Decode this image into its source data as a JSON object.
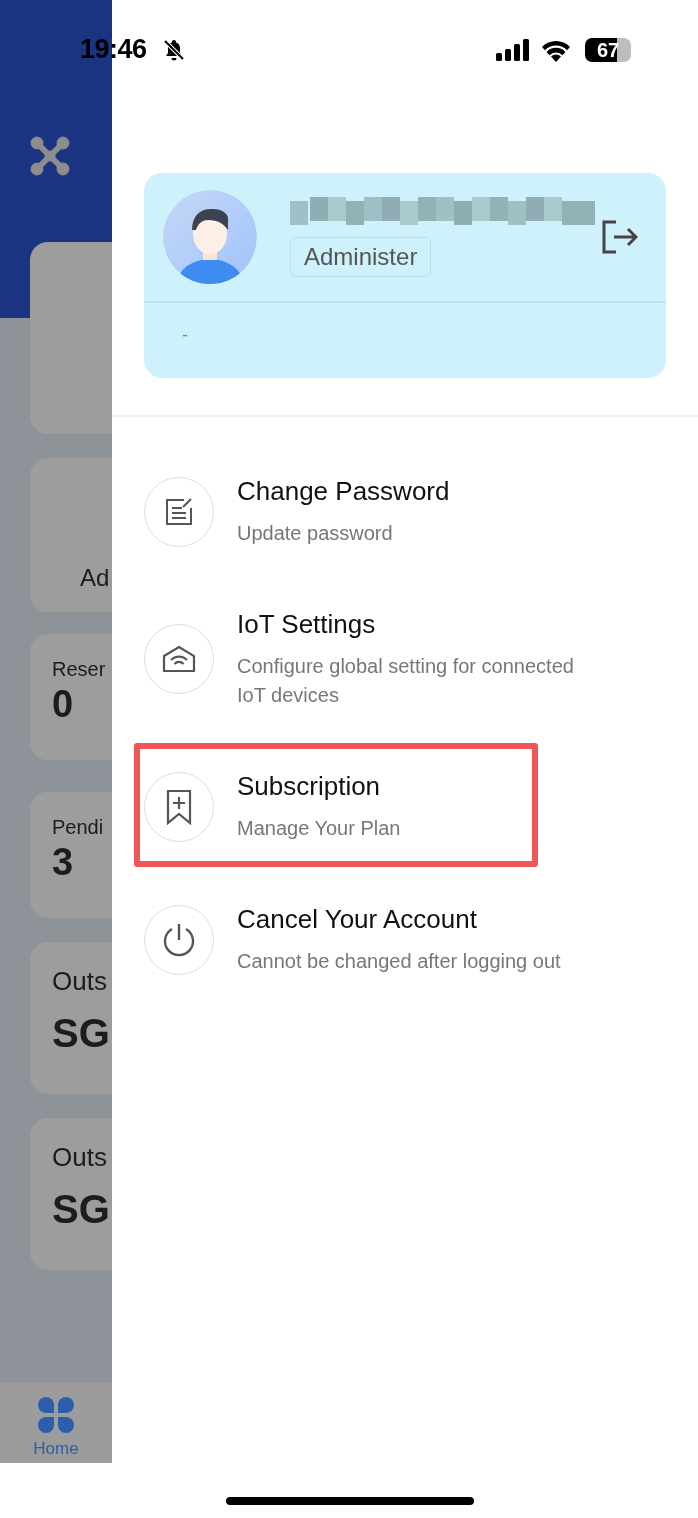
{
  "status_bar": {
    "time": "19:46",
    "battery": "67"
  },
  "background_app": {
    "cards": [
      {
        "kind": "blank"
      },
      {
        "kind": "action",
        "label": "Ad"
      },
      {
        "kind": "count",
        "label": "Reser",
        "value": "0"
      },
      {
        "kind": "count",
        "label": "Pendi",
        "value": "3"
      },
      {
        "kind": "amount",
        "label": "Outs",
        "value": "SG"
      },
      {
        "kind": "amount",
        "label": "Outs",
        "value": "SG"
      }
    ],
    "tab_bar": [
      {
        "label": "Home",
        "selected": true
      }
    ]
  },
  "drawer": {
    "profile": {
      "role": "Administer",
      "detail": "-"
    },
    "menu": [
      {
        "title": "Change Password",
        "subtitle": "Update password",
        "highlighted": false
      },
      {
        "title": "IoT Settings",
        "subtitle": "Configure global setting for connected IoT devices",
        "highlighted": false
      },
      {
        "title": "Subscription",
        "subtitle": "Manage Your Plan",
        "highlighted": true
      },
      {
        "title": "Cancel Your Account",
        "subtitle": "Cannot be changed after logging out",
        "highlighted": false
      }
    ]
  }
}
